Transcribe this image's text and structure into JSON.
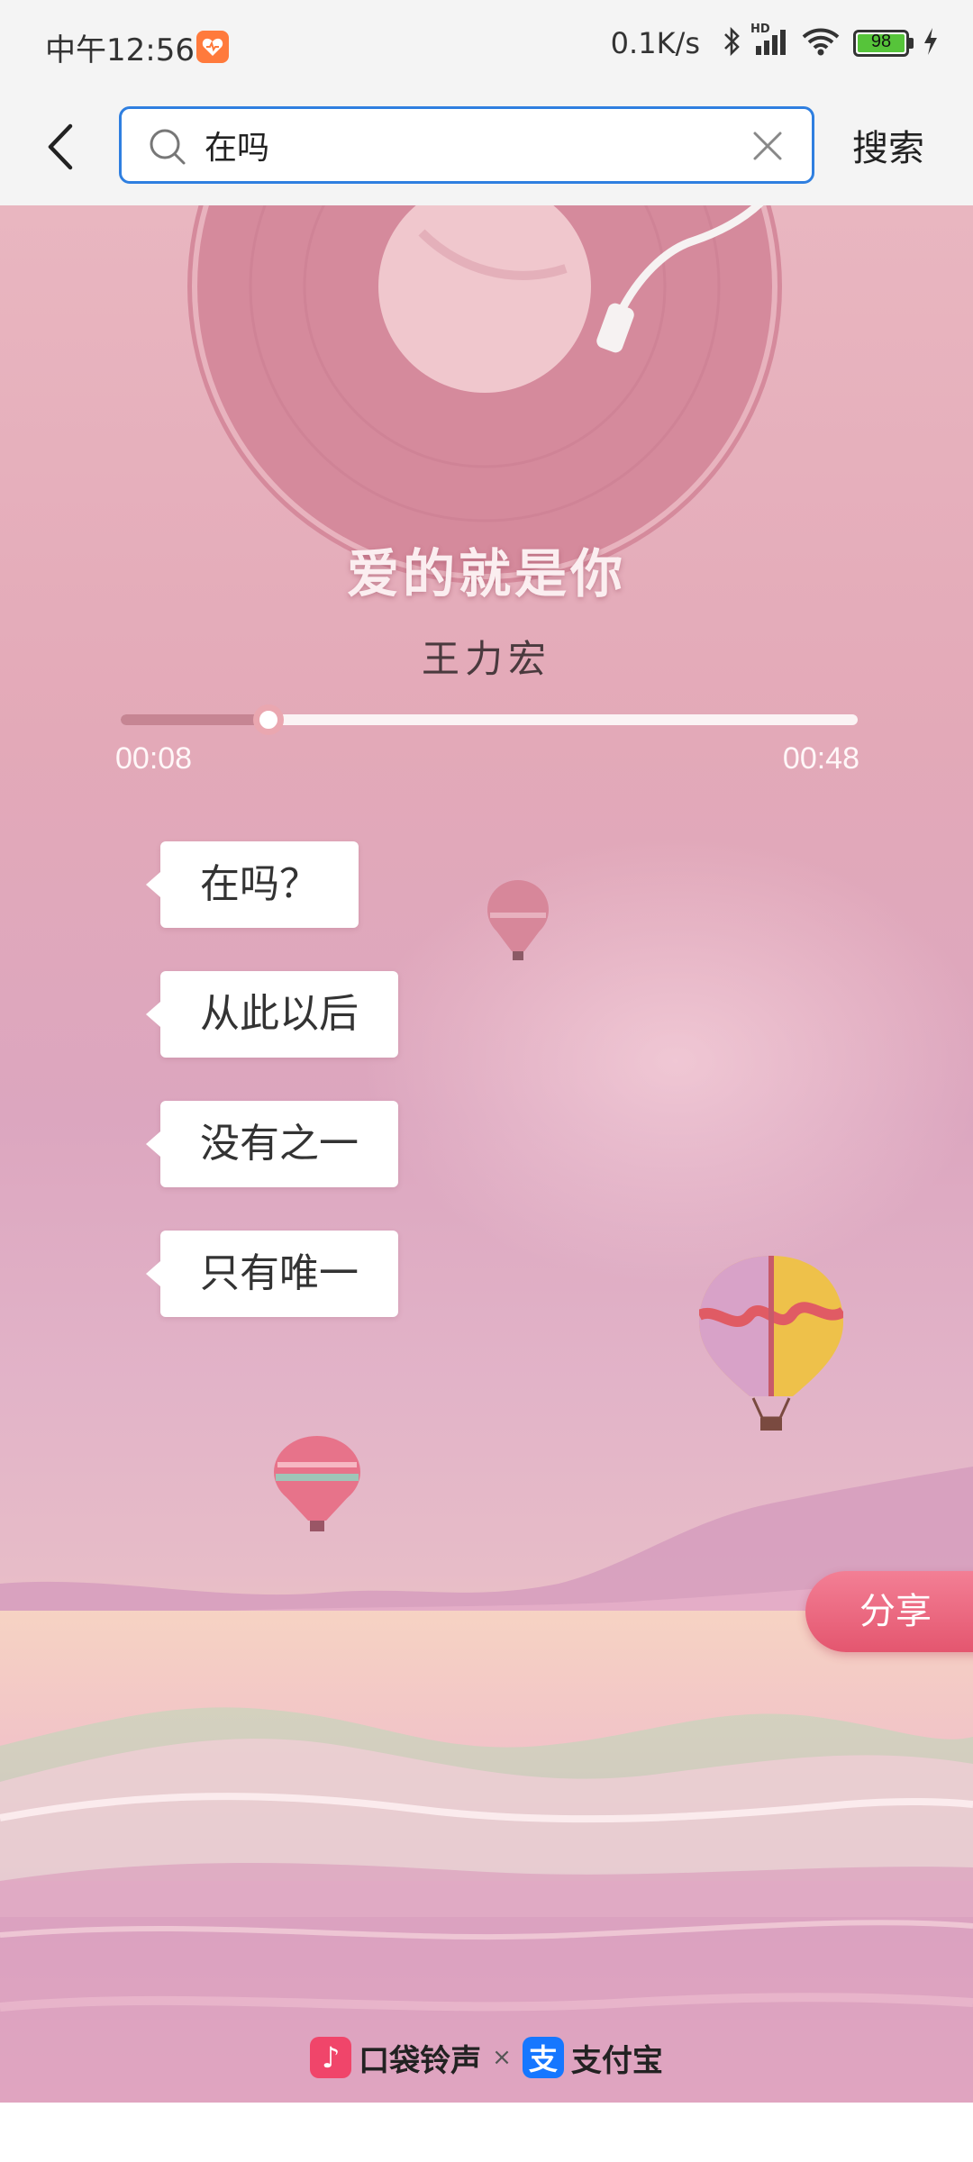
{
  "status_bar": {
    "time": "中午12:56",
    "net_speed": "0.1K/s",
    "hd_label": "HD",
    "battery_level": "98",
    "icons": [
      "app-notification-icon",
      "bluetooth-icon",
      "signal-icon",
      "wifi-icon",
      "battery-icon",
      "charging-icon"
    ]
  },
  "search": {
    "query": "在吗",
    "button_label": "搜索",
    "icons": [
      "back-arrow-icon",
      "search-icon",
      "clear-icon"
    ],
    "accent_color": "#2f7fe0"
  },
  "player": {
    "title": "爱的就是你",
    "artist": "王力宏",
    "current_time": "00:08",
    "total_time": "00:48",
    "progress": 0.2
  },
  "lyrics": [
    {
      "text": "在吗？"
    },
    {
      "text": "从此以后"
    },
    {
      "text": "没有之一"
    },
    {
      "text": "只有唯一"
    }
  ],
  "share_label": "分享",
  "brands": {
    "left_logo_char": "♪",
    "left_name": "口袋铃声",
    "separator": "×",
    "right_logo_char": "支",
    "right_name": "支付宝"
  },
  "colors": {
    "share_button": "#e4566f",
    "progress_fill": "#c68593",
    "pocket_brand": "#f0456a",
    "alipay_brand": "#1677ff"
  }
}
